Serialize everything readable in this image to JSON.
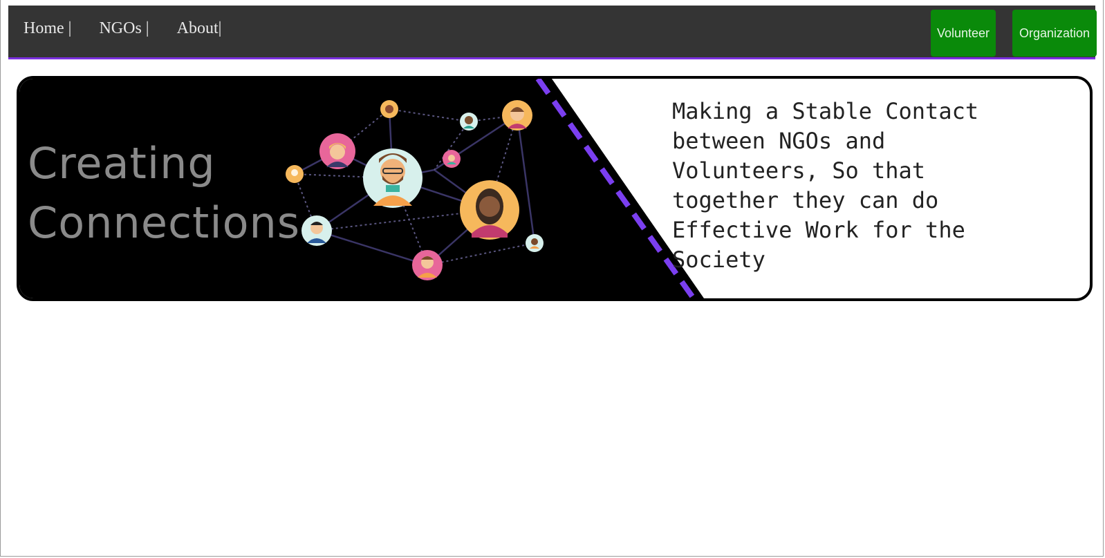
{
  "nav": {
    "links": [
      {
        "label": "Home |"
      },
      {
        "label": "NGOs |"
      },
      {
        "label": "About|"
      }
    ],
    "buttons": {
      "volunteer": "Volunteer",
      "organization": "Organization"
    }
  },
  "hero": {
    "title_line1": "Creating",
    "title_line2": "Connections",
    "tagline": "Making a Stable Contact between NGOs and Volunteers, So that together they can do Effective Work for the Society"
  },
  "colors": {
    "navbar": "#343434",
    "accent_purple": "#7b2fe0",
    "button_green": "#0a8a0a"
  }
}
